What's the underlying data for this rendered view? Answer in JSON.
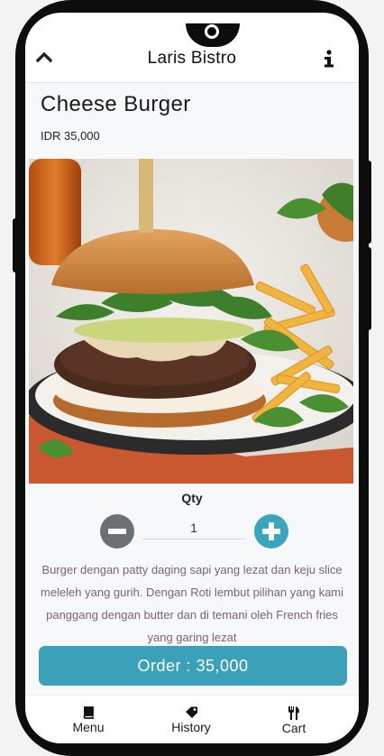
{
  "header": {
    "title": "Laris Bistro",
    "back_icon": "chevron-up-icon",
    "info_icon": "info-icon"
  },
  "product": {
    "name": "Cheese Burger",
    "price": "IDR 35,000",
    "image": "cheese-burger-with-fries-photo",
    "description": "Burger dengan patty daging sapi yang lezat dan keju slice meleleh yang gurih. Dengan Roti lembut pilihan yang kami panggang dengan butter dan di temani oleh French fries yang garing lezat"
  },
  "quantity": {
    "label": "Qty",
    "value": "1",
    "minus_icon": "minus-circle-icon",
    "plus_icon": "plus-circle-icon"
  },
  "order": {
    "label": "Order : 35,000"
  },
  "bottom_nav": {
    "items": [
      {
        "label": "Menu",
        "icon": "book-icon"
      },
      {
        "label": "History",
        "icon": "tag-icon"
      },
      {
        "label": "Cart",
        "icon": "utensils-icon"
      }
    ]
  },
  "colors": {
    "accent": "#3aa1b8",
    "minus_button": "#6a7074",
    "description_text": "#7a6470"
  }
}
